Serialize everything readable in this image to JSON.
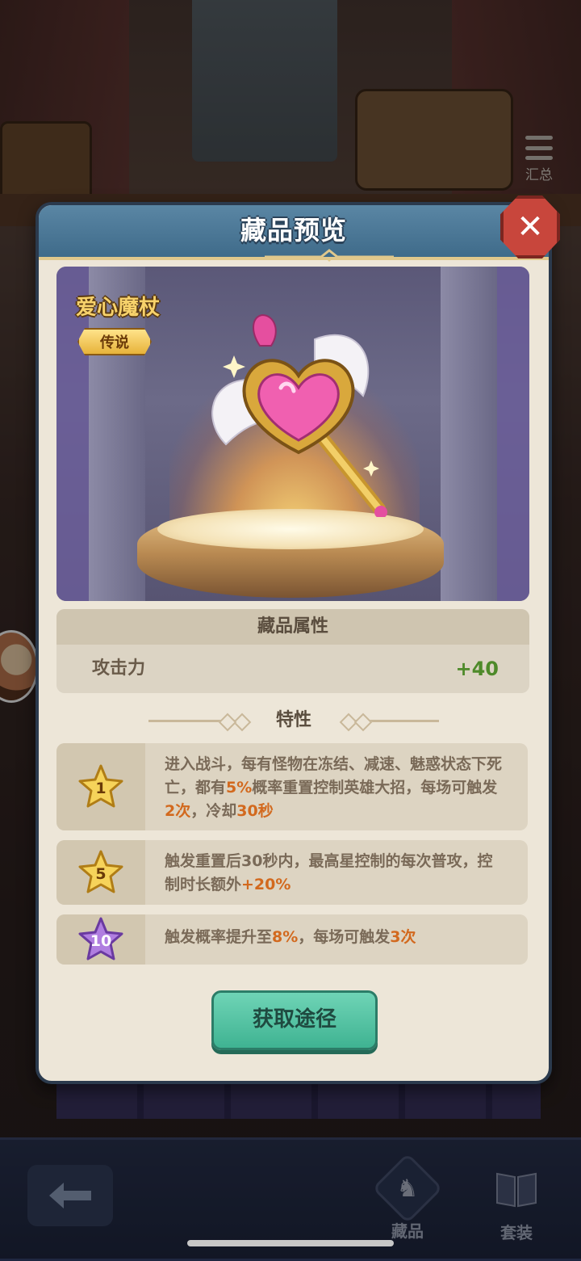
{
  "background": {
    "summary_label": "汇总",
    "nav": {
      "collection_label": "藏品",
      "set_label": "套装"
    }
  },
  "dialog": {
    "title": "藏品预览",
    "item": {
      "name": "爱心魔杖",
      "rarity": "传说"
    },
    "attributes": {
      "heading": "藏品属性",
      "rows": [
        {
          "label": "攻击力",
          "value": "+40"
        }
      ]
    },
    "traits": {
      "heading": "特性",
      "items": [
        {
          "star": "1",
          "star_color": "gold",
          "text": [
            "进入战斗，每有怪物在冻结、减速、魅惑状态下死亡，都有",
            "5%",
            "概率重置控制英雄大招，每场可触发",
            "2次",
            "，冷却",
            "30秒"
          ]
        },
        {
          "star": "5",
          "star_color": "gold",
          "text": [
            "触发重置后30秒内，最高星控制的每次普攻，控制时长额外",
            "+20%"
          ]
        },
        {
          "star": "10",
          "star_color": "purple",
          "text": [
            "触发概率提升至",
            "8%",
            "，每场可触发",
            "3次"
          ]
        }
      ]
    },
    "acquire_button": "获取途径"
  },
  "colors": {
    "header": "#4a7696",
    "highlight": "#d2691e",
    "positive": "#4e8a2a",
    "button": "#4fc3a1",
    "close": "#c8463c"
  }
}
